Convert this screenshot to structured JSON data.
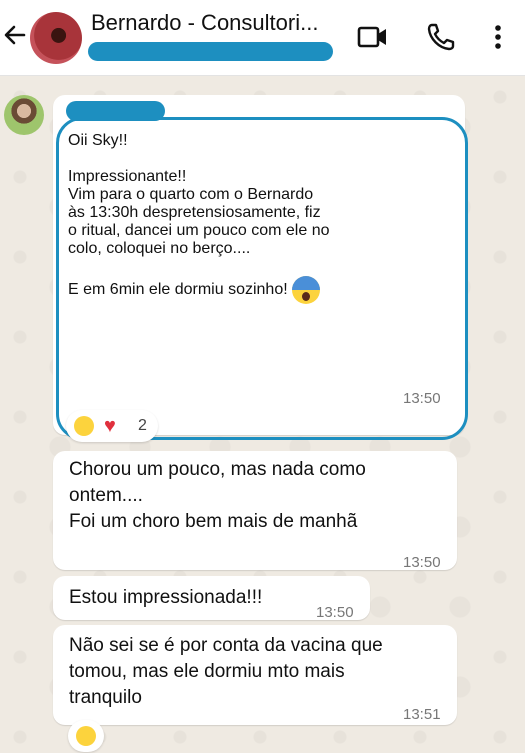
{
  "header": {
    "contact_name": "Bernardo - Consultori...",
    "icons": [
      "back-arrow-icon",
      "video-call-icon",
      "phone-icon",
      "more-options-icon"
    ]
  },
  "messages": [
    {
      "text": "Oii Sky!!\n\nImpressionante!!\nVim para o quarto com o Bernardo\nàs 13:30h despretensiosamente, fiz\no ritual, dancei um pouco com ele no\ncolo, coloquei no berço....\n\nE em 6min ele dormiu sozinho!",
      "emoji": "face-screaming-in-fear",
      "time": "13:50",
      "reactions": {
        "emojis": [
          "squinting-tongue-face",
          "red-heart"
        ],
        "count": "2"
      }
    },
    {
      "text": "Chorou um pouco, mas nada como\nontem....\nFoi um choro bem mais de manhã",
      "time": "13:50"
    },
    {
      "text": "Estou impressionada!!!",
      "time": "13:50"
    },
    {
      "text": "Não sei se é por conta da vacina que\ntomou, mas ele dormiu mto mais\ntranquilo",
      "time": "13:51",
      "reactions": {
        "emojis": [
          "grinning-sweat-face"
        ]
      }
    }
  ],
  "colors": {
    "highlight": "#1d8fc0",
    "chat_background": "#efeae2",
    "bubble": "#ffffff"
  }
}
